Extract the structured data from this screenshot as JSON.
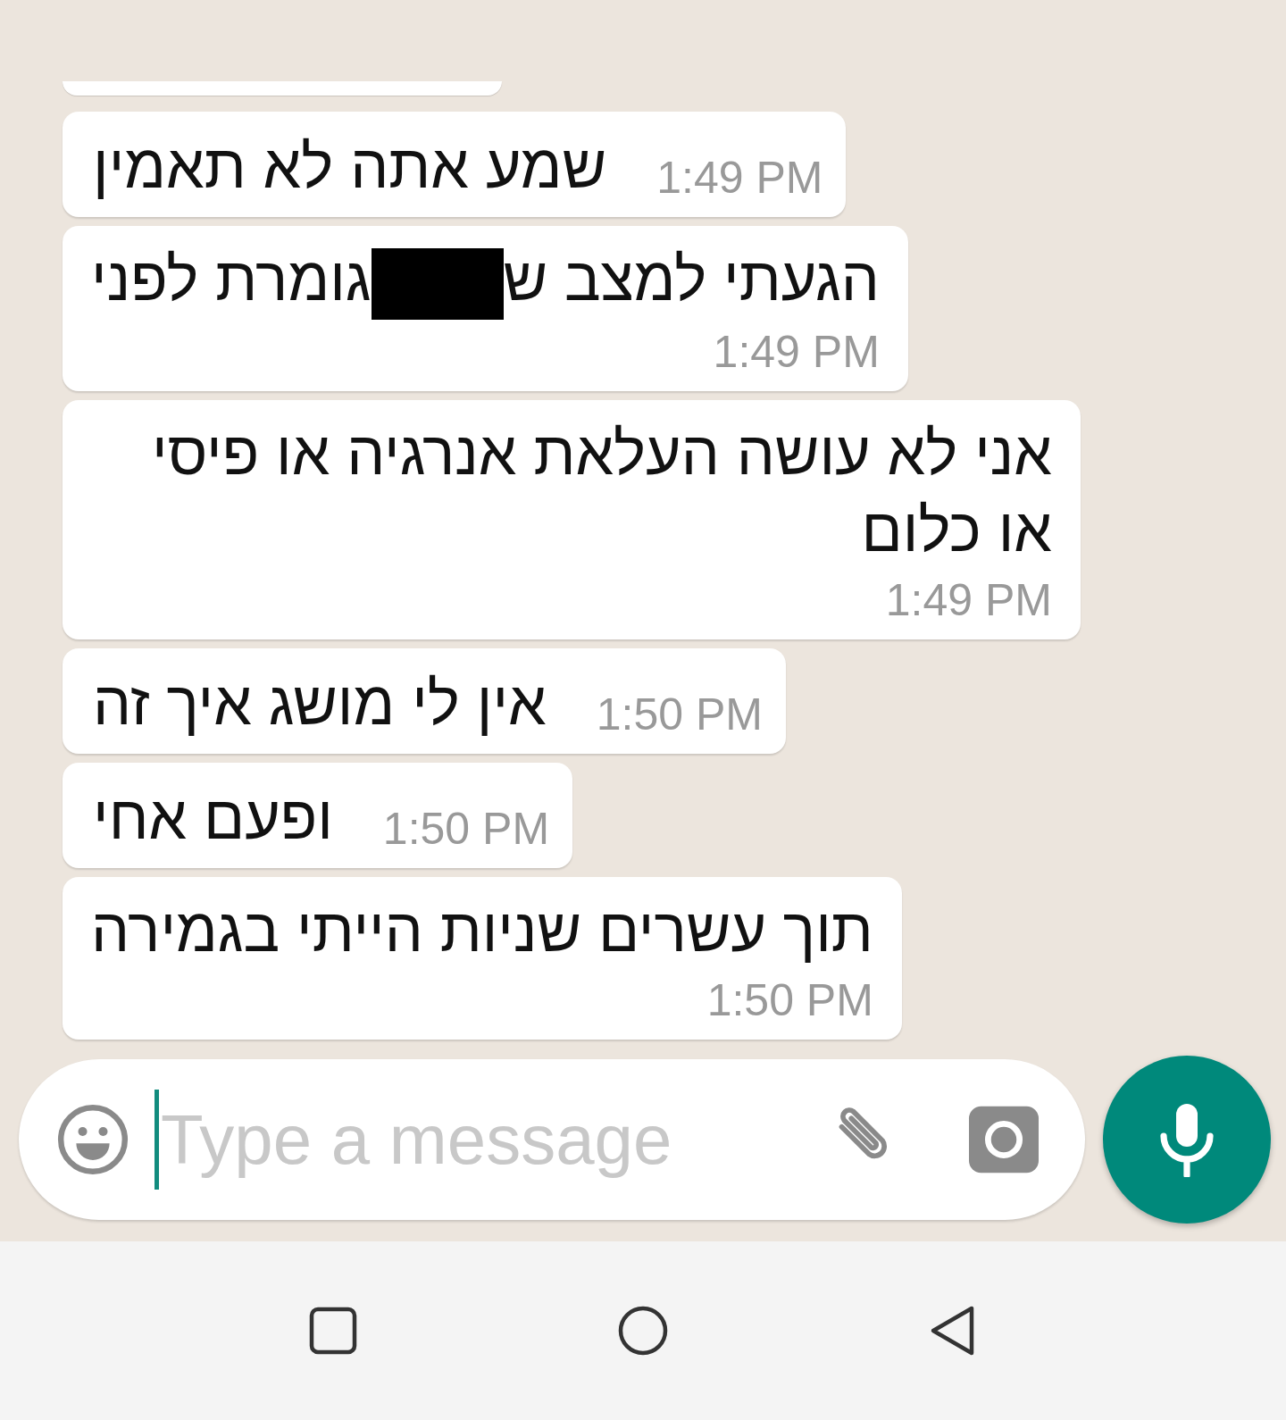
{
  "earlier_message_cut_off": true,
  "messages": [
    {
      "kind": "inline",
      "time": "1:49 PM",
      "parts": [
        {
          "kind": "text",
          "text": "שמע אתה לא תאמין"
        }
      ]
    },
    {
      "kind": "stacked",
      "time": "1:49 PM",
      "parts": [
        {
          "kind": "text",
          "text": "הגעתי למצב ש"
        },
        {
          "kind": "redaction"
        },
        {
          "kind": "text",
          "text": "גומרת לפני"
        }
      ]
    },
    {
      "kind": "stacked",
      "time": "1:49 PM",
      "parts": [
        {
          "kind": "text",
          "text": "אני לא עושה העלאת אנרגיה או פיסי או כלום"
        }
      ]
    },
    {
      "kind": "inline",
      "time": "1:50 PM",
      "parts": [
        {
          "kind": "text",
          "text": "אין לי מושג איך זה"
        }
      ]
    },
    {
      "kind": "inline",
      "time": "1:50 PM",
      "parts": [
        {
          "kind": "text",
          "text": "ופעם אחי"
        }
      ]
    },
    {
      "kind": "stacked",
      "time": "1:50 PM",
      "parts": [
        {
          "kind": "text",
          "text": "תוך עשרים שניות הייתי בגמירה"
        }
      ]
    }
  ],
  "composer": {
    "placeholder": "Type a message"
  }
}
